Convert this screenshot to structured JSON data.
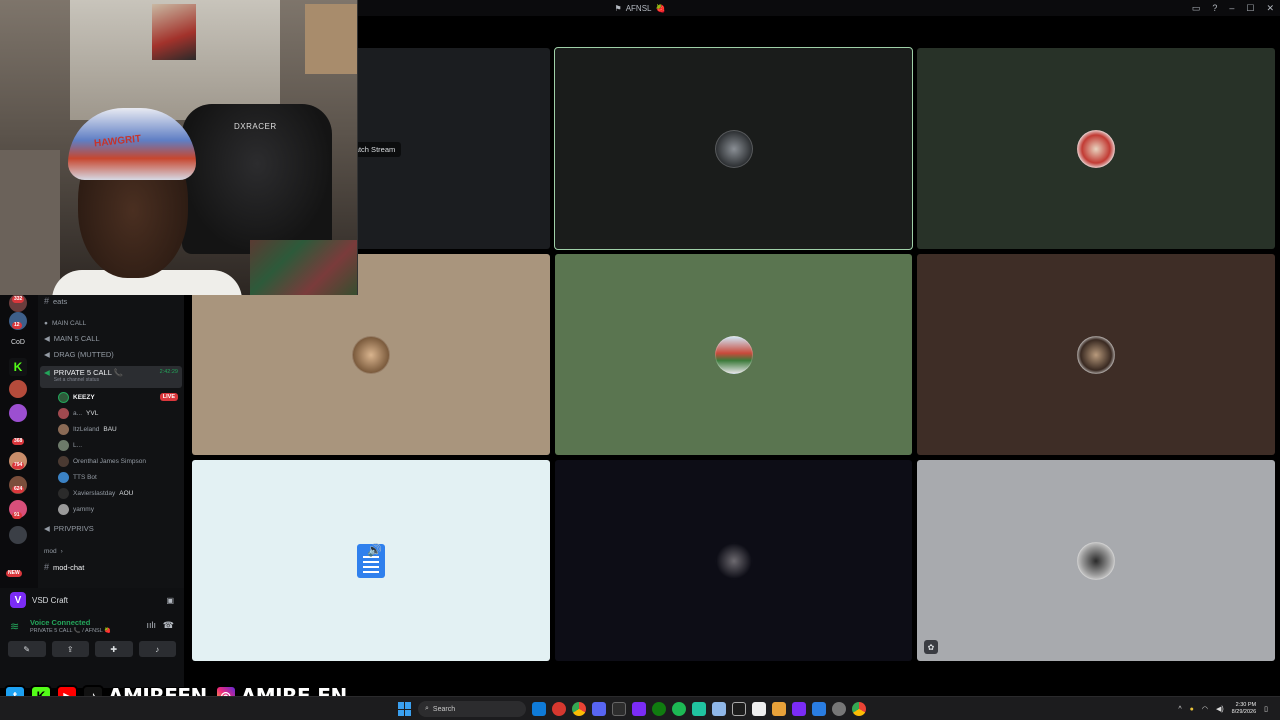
{
  "window": {
    "title": "AFNSL",
    "title_emoji": "🍓"
  },
  "server_rail": {
    "badges": [
      "332",
      "12",
      "368",
      "794",
      "624",
      "91",
      "NEW"
    ],
    "cod_label": "CoD"
  },
  "channels": {
    "top_channel": "eats",
    "category_main": "MAIN CALL",
    "voice_main5": "MAIN 5 CALL",
    "voice_drag": "DRAG (MUTTED)",
    "active_channel": "PRIVATE 5 CALL",
    "active_channel_emoji": "📞",
    "active_timer": "2:42:29",
    "status_hint": "Set a channel status",
    "members": [
      {
        "name": "KEEZY",
        "tag": "",
        "live": "LIVE"
      },
      {
        "name": "a...",
        "tag": "YVL"
      },
      {
        "name": "ItzLeland",
        "tag": "BAU"
      },
      {
        "name": "L...",
        "tag": ""
      },
      {
        "name": "Orenthal James Simpson",
        "tag": ""
      },
      {
        "name": "TTS Bot",
        "tag": ""
      },
      {
        "name": "Xavierslastday",
        "tag": "AOU"
      },
      {
        "name": "yammy",
        "tag": ""
      }
    ],
    "voice_privprivs": "PRIVPRIVS",
    "category_mod": "mod",
    "mod_chat": "mod-chat"
  },
  "user_panel": {
    "app_name": "VSD Craft",
    "voice_status": "Voice Connected",
    "voice_location": "PRIVATE 5 CALL 📞 / AFNSL 🍓"
  },
  "grid": {
    "tile1_label": "Watch Stream",
    "tile_colors": [
      "#1b1d20",
      "#1a1c1b",
      "#283228",
      "#a9957d",
      "#5a7550",
      "#3e2d26",
      "#e3f1f3",
      "#0d0d16",
      "#a8aaae"
    ]
  },
  "overlay": {
    "tiktok_handle": "AMIREFN",
    "instagram_handle": "AMIRE.FN"
  },
  "taskbar": {
    "search_placeholder": "Search",
    "time": "2:30 PM",
    "date": "8/29/2026"
  }
}
